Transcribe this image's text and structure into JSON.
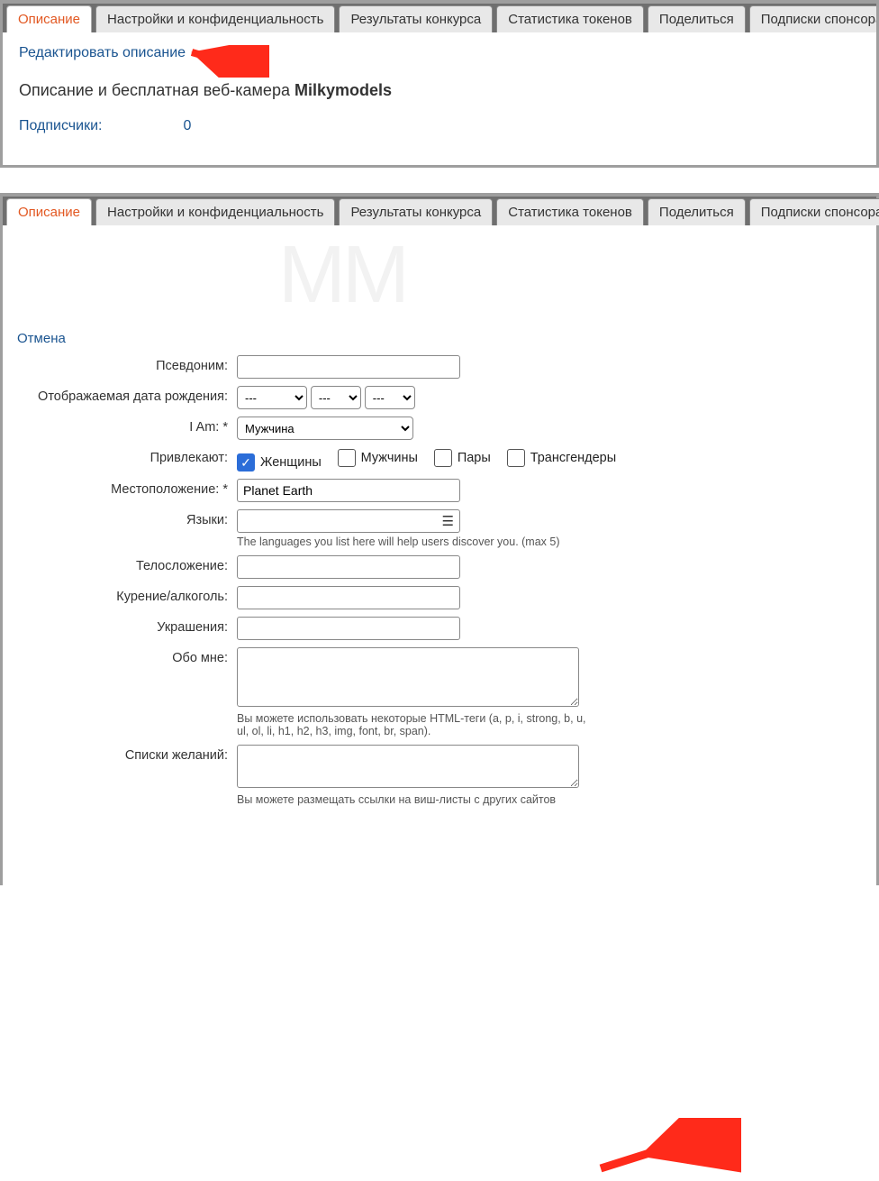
{
  "tabs": {
    "description": "Описание",
    "settings": "Настройки и конфиденциальность",
    "contest": "Результаты конкурса",
    "tokens": "Статистика токенов",
    "share": "Поделиться",
    "sponsor": "Подписки спонсора"
  },
  "top": {
    "edit_link": "Редактировать описание",
    "heading_prefix": "Описание и бесплатная веб-камера ",
    "heading_name": "Milkymodels",
    "subs_label": "Подписчики:",
    "subs_count": "0"
  },
  "form": {
    "cancel": "Отмена",
    "labels": {
      "alias": "Псевдоним:",
      "birth": "Отображаемая дата рождения:",
      "iam": "I Am: *",
      "attracted": "Привлекают:",
      "location": "Местоположение: *",
      "languages": "Языки:",
      "body": "Телосложение:",
      "smoke": "Курение/алкоголь:",
      "decor": "Украшения:",
      "about": "Обо мне:",
      "wishlists": "Списки желаний:"
    },
    "birth_placeholder": "---",
    "iam_value": "Мужчина",
    "attracted_options": {
      "women": "Женщины",
      "men": "Мужчины",
      "couples": "Пары",
      "trans": "Трансгендеры"
    },
    "location_value": "Planet Earth",
    "languages_hint": "The languages you list here will help users discover you. (max 5)",
    "about_hint": "Вы можете использовать некоторые HTML-теги (a, p, i, strong, b, u, ul, ol, li, h1, h2, h3, img, font, br, span).",
    "wishlists_hint": "Вы можете размещать ссылки на виш-листы с других сайтов"
  },
  "watermark": "MM"
}
